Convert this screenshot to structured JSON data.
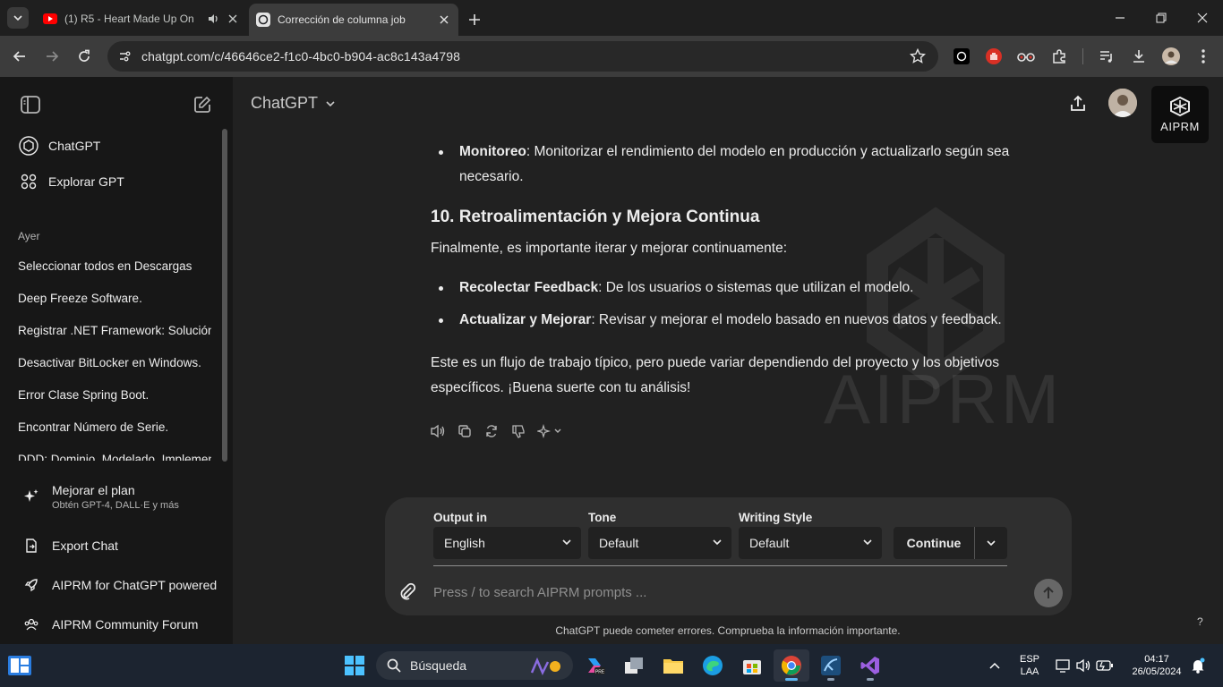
{
  "browser": {
    "tabs": [
      {
        "title": "(1) R5 - Heart Made Up On",
        "favicon": "youtube-icon",
        "audio": true
      },
      {
        "title": "Corrección de columna job",
        "favicon": "chatgpt-icon",
        "active": true
      }
    ],
    "url": "chatgpt.com/c/46646ce2-f1c0-4bc0-b904-ac8c143a4798"
  },
  "sidebar": {
    "nav": [
      {
        "label": "ChatGPT",
        "icon": "chatgpt-logo-icon"
      },
      {
        "label": "Explorar GPT",
        "icon": "grid-icon"
      }
    ],
    "section_label": "Ayer",
    "history": [
      "Seleccionar todos en Descargas",
      "Deep Freeze Software.",
      "Registrar .NET Framework: Solución",
      "Desactivar BitLocker en Windows.",
      "Error Clase Spring Boot.",
      "Encontrar Número de Serie.",
      "DDD: Dominio, Modelado, Implementación"
    ],
    "upgrade": {
      "title": "Mejorar el plan",
      "subtitle": "Obtén GPT-4, DALL·E y más"
    },
    "bottom_links": [
      "Export Chat",
      "AIPRM for ChatGPT powered",
      "AIPRM Community Forum"
    ]
  },
  "header": {
    "model": "ChatGPT",
    "aiprm_badge": "AIPRM"
  },
  "message": {
    "bullet_monitoreo": {
      "term": "Monitoreo",
      "text": ": Monitorizar el rendimiento del modelo en producción y actualizarlo según sea necesario."
    },
    "heading": "10. Retroalimentación y Mejora Continua",
    "intro": "Finalmente, es importante iterar y mejorar continuamente:",
    "bullets": [
      {
        "term": "Recolectar Feedback",
        "text": ": De los usuarios o sistemas que utilizan el modelo."
      },
      {
        "term": "Actualizar y Mejorar",
        "text": ": Revisar y mejorar el modelo basado en nuevos datos y feedback."
      }
    ],
    "closing": "Este es un flujo de trabajo típico, pero puede variar dependiendo del proyecto y los objetivos específicos. ¡Buena suerte con tu análisis!"
  },
  "composer": {
    "output_label": "Output in",
    "output_value": "English",
    "tone_label": "Tone",
    "tone_value": "Default",
    "style_label": "Writing Style",
    "style_value": "Default",
    "continue_label": "Continue",
    "placeholder": "Press / to search AIPRM prompts ..."
  },
  "disclaimer": "ChatGPT puede cometer errores. Comprueba la información importante.",
  "help": "?",
  "taskbar": {
    "search_label": "Búsqueda",
    "lang_line1": "ESP",
    "lang_line2": "LAA",
    "time": "04:17",
    "date": "26/05/2024"
  }
}
